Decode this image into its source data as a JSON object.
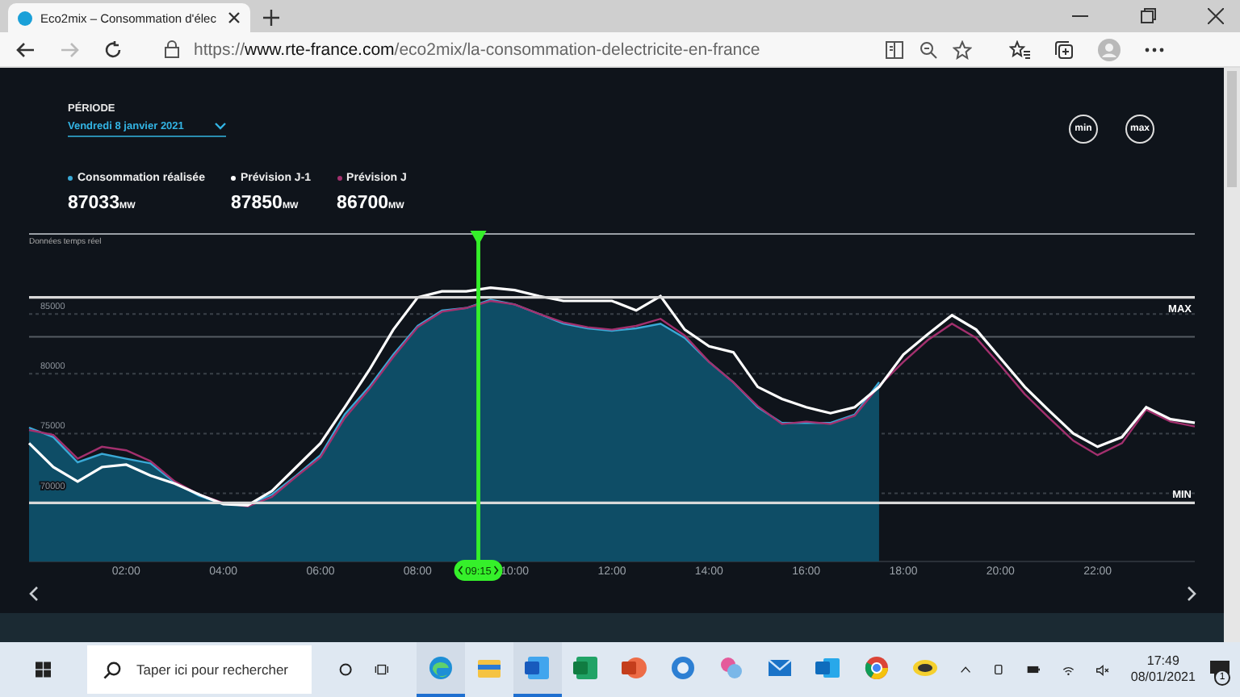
{
  "browser": {
    "tab_title": "Eco2mix – Consommation d'élec",
    "url_scheme": "https://",
    "url_host": "www.rte-france.com",
    "url_path": "/eco2mix/la-consommation-delectricite-en-france"
  },
  "page": {
    "period_label": "PÉRIODE",
    "period_value": "Vendredi 8 janvier 2021",
    "buttons": [
      "min",
      "max"
    ],
    "legend": [
      {
        "value": "87033",
        "unit": "MW"
      },
      {
        "value": "87850",
        "unit": "MW"
      },
      {
        "value": "86700",
        "unit": "MW"
      }
    ],
    "realtime_label": "Données temps réel",
    "chart_data": {
      "type": "line",
      "xlim": [
        0,
        24
      ],
      "ylim": [
        64300,
        91700
      ],
      "grid": true,
      "x": [
        0,
        0.5,
        1,
        1.5,
        2,
        2.5,
        3,
        3.5,
        4,
        4.5,
        5,
        5.5,
        6,
        6.5,
        7,
        7.5,
        8,
        8.5,
        9,
        9.5,
        10,
        10.5,
        11,
        11.5,
        12,
        12.5,
        13,
        13.5,
        14,
        14.5,
        15,
        15.5,
        16,
        16.5,
        17,
        17.5,
        18,
        18.5,
        19,
        19.5,
        20,
        20.5,
        21,
        21.5,
        22,
        22.5,
        23,
        23.5,
        24
      ],
      "xticks": [
        {
          "value": 2,
          "label": "02:00"
        },
        {
          "value": 4,
          "label": "04:00"
        },
        {
          "value": 6,
          "label": "06:00"
        },
        {
          "value": 8,
          "label": "08:00"
        },
        {
          "value": 10,
          "label": "10:00"
        },
        {
          "value": 12,
          "label": "12:00"
        },
        {
          "value": 14,
          "label": "14:00"
        },
        {
          "value": 16,
          "label": "16:00"
        },
        {
          "value": 18,
          "label": "18:00"
        },
        {
          "value": 20,
          "label": "20:00"
        },
        {
          "value": 22,
          "label": "22:00"
        }
      ],
      "yticks": [
        70000,
        75000,
        80000,
        85000
      ],
      "series": [
        {
          "name": "Consommation réalisée",
          "color": "#3aa9d6",
          "type": "area",
          "values": [
            75500,
            74700,
            72600,
            73300,
            72900,
            72500,
            70900,
            69800,
            69100,
            69000,
            69900,
            71500,
            73200,
            76600,
            78900,
            81600,
            84000,
            85300,
            85500,
            86200,
            85800,
            85000,
            84200,
            83800,
            83600,
            83800,
            84200,
            83000,
            81000,
            79300,
            77200,
            75900,
            75900,
            75900,
            76600,
            79300,
            null,
            null,
            null,
            null,
            null,
            null,
            null,
            null,
            null,
            null,
            null,
            null,
            null
          ]
        },
        {
          "name": "Prévision J-1",
          "color": "#ffffff",
          "values": [
            74200,
            72200,
            71000,
            72200,
            72400,
            71500,
            70800,
            69900,
            69100,
            69000,
            70200,
            72200,
            74200,
            77200,
            80300,
            83700,
            86400,
            86900,
            86900,
            87200,
            87000,
            86500,
            86100,
            86100,
            86100,
            85300,
            86500,
            83700,
            82300,
            81800,
            78900,
            77900,
            77200,
            76700,
            77200,
            78900,
            81600,
            83300,
            84900,
            83700,
            81300,
            78900,
            76900,
            75000,
            73900,
            74700,
            77200,
            76200,
            75900
          ]
        },
        {
          "name": "Prévision J",
          "color": "#a3306e",
          "values": [
            75300,
            74900,
            72900,
            73900,
            73600,
            72700,
            71000,
            69900,
            69200,
            68900,
            69700,
            71400,
            73000,
            76300,
            78700,
            81400,
            83900,
            85200,
            85500,
            86100,
            85800,
            85000,
            84300,
            83900,
            83700,
            84000,
            84600,
            83200,
            81000,
            79300,
            77300,
            75800,
            76000,
            75800,
            76500,
            79000,
            81000,
            82800,
            84200,
            83000,
            80700,
            78300,
            76300,
            74400,
            73200,
            74200,
            77000,
            76000,
            75600
          ]
        }
      ],
      "ref_lines": [
        {
          "axis": "y",
          "value": 86400,
          "label": "MAX"
        },
        {
          "axis": "y",
          "value": 69200,
          "label": "MIN"
        },
        {
          "axis": "y",
          "value": 83100
        },
        {
          "axis": "x",
          "value": 9.25,
          "label": "09:15"
        }
      ]
    }
  },
  "taskbar": {
    "search_placeholder": "Taper ici pour rechercher",
    "apps": [
      {
        "running": true
      },
      {
        "running": false
      },
      {
        "running": true
      },
      {
        "running": false
      },
      {
        "running": false
      },
      {
        "running": false
      },
      {
        "running": false
      },
      {
        "running": false
      },
      {
        "running": false
      },
      {
        "running": false
      },
      {
        "running": false
      }
    ],
    "time": "17:49",
    "date": "08/01/2021",
    "notifications": "1"
  }
}
